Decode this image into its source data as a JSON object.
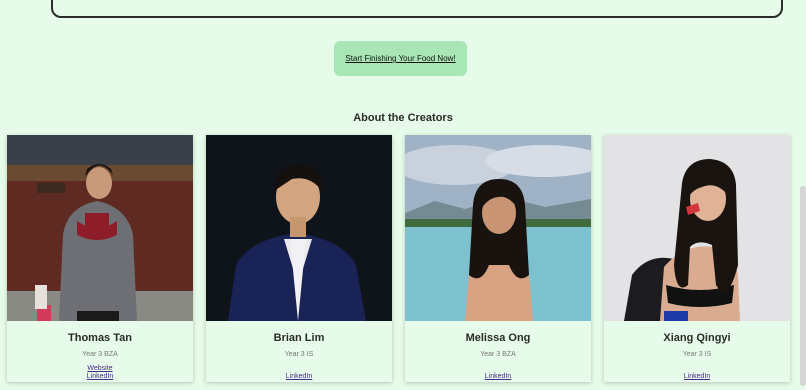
{
  "cta": {
    "label": "Start Finishing Your Food Now!"
  },
  "section": {
    "title": "About the Creators"
  },
  "creators": [
    {
      "name": "Thomas Tan",
      "year": "Year 3 BZA",
      "links": [
        "Website",
        "LinkedIn"
      ]
    },
    {
      "name": "Brian Lim",
      "year": "Year 3 IS",
      "links": [
        "LinkedIn"
      ]
    },
    {
      "name": "Melissa Ong",
      "year": "Year 3 BZA",
      "links": [
        "LinkedIn"
      ]
    },
    {
      "name": "Xiang Qingyi",
      "year": "Year 3 IS",
      "links": [
        "LinkedIn"
      ]
    }
  ],
  "colors": {
    "background": "#e6fbe9",
    "button": "#a8e6b5",
    "link": "#4a2a8a"
  }
}
